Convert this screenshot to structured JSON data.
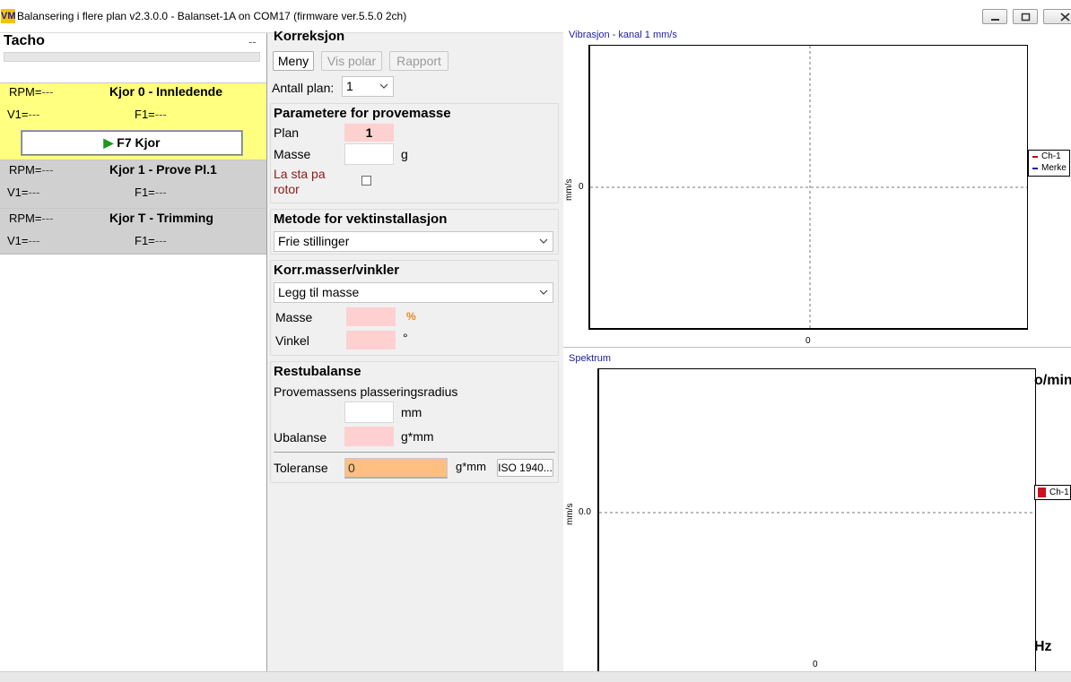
{
  "window": {
    "title": "Balansering i flere plan v2.3.0.0 - Balanset-1A on COM17 (firmware ver.5.5.0 2ch)",
    "icon_text": "VM"
  },
  "left": {
    "tacho_title": "Tacho",
    "tacho_value": "--",
    "runs": [
      {
        "name": "Kjor 0 - Innledende",
        "rpm_label": "RPM=",
        "rpm_value": "---",
        "v1_label": "V1=",
        "v1_value": "---",
        "f1_label": "F1=",
        "f1_value": "---"
      },
      {
        "name": "Kjor 1 - Prove Pl.1",
        "rpm_label": "RPM=",
        "rpm_value": "---",
        "v1_label": "V1=",
        "v1_value": "---",
        "f1_label": "F1=",
        "f1_value": "---"
      },
      {
        "name": "Kjor T - Trimming",
        "rpm_label": "RPM=",
        "rpm_value": "---",
        "v1_label": "V1=",
        "v1_value": "---",
        "f1_label": "F1=",
        "f1_value": "---"
      }
    ],
    "run_button": "F7 Kjor"
  },
  "correction": {
    "title": "Korreksjon",
    "buttons": {
      "menu": "Meny",
      "polar": "Vis polar",
      "report": "Rapport"
    },
    "planes_label": "Antall plan:",
    "planes_value": "1",
    "trial": {
      "title": "Parametere for provemasse",
      "plane_label": "Plan",
      "plane_value": "1",
      "mass_label": "Masse",
      "mass_value": "",
      "mass_unit": "g",
      "leave_label_1": "La sta pa",
      "leave_label_2": "rotor"
    },
    "method": {
      "title": "Metode for vektinstallasjon",
      "value": "Frie stillinger"
    },
    "corr_masses": {
      "title": "Korr.masser/vinkler",
      "value": "Legg til masse",
      "mass_label": "Masse",
      "mass_unit": "%",
      "angle_label": "Vinkel",
      "angle_unit": "°"
    },
    "residual": {
      "title": "Restubalanse",
      "radius_label": "Provemassens plasseringsradius",
      "radius_unit": "mm",
      "unbalance_label": "Ubalanse",
      "unbalance_unit": "g*mm",
      "tolerance_label": "Toleranse",
      "tolerance_value": "0",
      "tolerance_unit": "g*mm",
      "iso_button": "ISO 1940..."
    }
  },
  "charts": {
    "vibration": {
      "title": "Vibrasjon - kanal 1 mm/s",
      "ylabel": "mm/s",
      "ytick_zero": "0",
      "xtick_zero": "0",
      "legend": [
        {
          "name": "Ch-1",
          "color": "#c00000"
        },
        {
          "name": "Merke",
          "color": "#1e1ea0"
        }
      ]
    },
    "spectrum": {
      "title": "Spektrum",
      "ylabel": "mm/s",
      "ytick_zero": "0.0",
      "xtick_zero": "0",
      "unit_top": "o/min",
      "unit_bottom": "Hz",
      "legend": [
        {
          "name": "Ch-1",
          "color": "#cc1020"
        }
      ]
    }
  },
  "chart_data": [
    {
      "type": "line",
      "title": "Vibrasjon - kanal 1 mm/s",
      "ylabel": "mm/s",
      "series": [
        {
          "name": "Ch-1",
          "values": []
        },
        {
          "name": "Merke",
          "values": []
        }
      ],
      "grid": "center crosshair",
      "legend": "right"
    },
    {
      "type": "bar",
      "title": "Spektrum",
      "ylabel": "mm/s",
      "series": [
        {
          "name": "Ch-1",
          "values": []
        }
      ],
      "legend": "right"
    }
  ]
}
